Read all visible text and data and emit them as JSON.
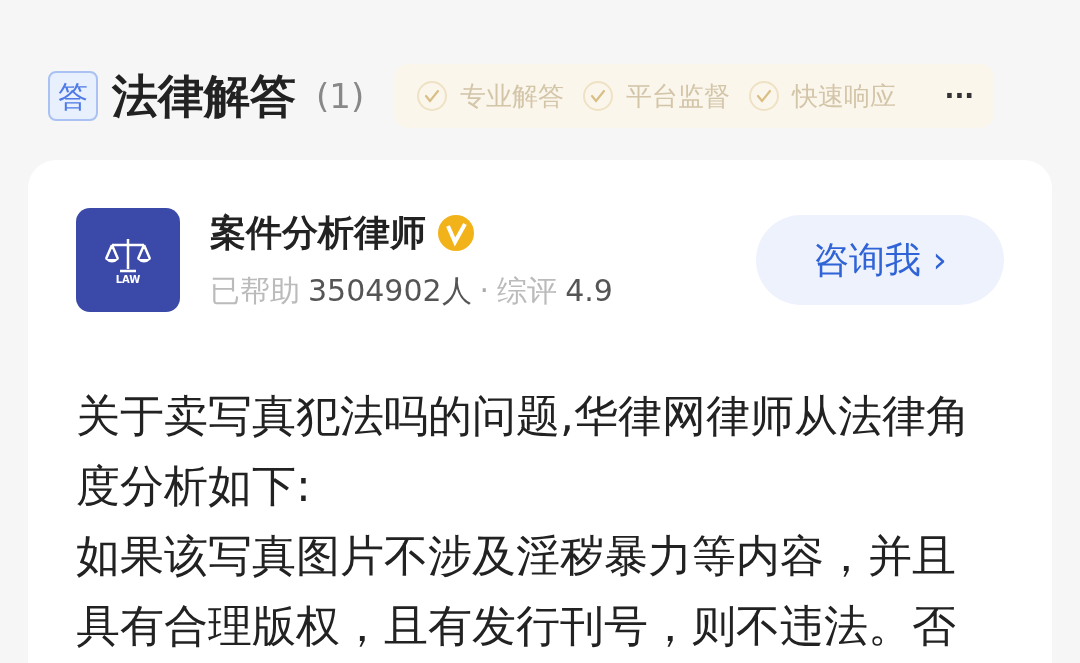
{
  "header": {
    "badge": "答",
    "title": "法律解答",
    "count": "(1)",
    "features": [
      {
        "label": "专业解答"
      },
      {
        "label": "平台监督"
      },
      {
        "label": "快速响应"
      }
    ],
    "more": "···"
  },
  "lawyer": {
    "logo_text": "LAW",
    "name": "案件分析律师",
    "verified": true,
    "helped_label": "已帮助",
    "helped_count": "3504902人",
    "separator": "·",
    "rating_label": "综评",
    "rating": "4.9",
    "consult_button": "咨询我 ›"
  },
  "answer": [
    "关于卖写真犯法吗的问题,华律网律师从法律角度分析如下:",
    "如果该写真图片不涉及淫秽暴力等内容，并且具有合理版权，且有发行刊号，则不违法。否"
  ]
}
